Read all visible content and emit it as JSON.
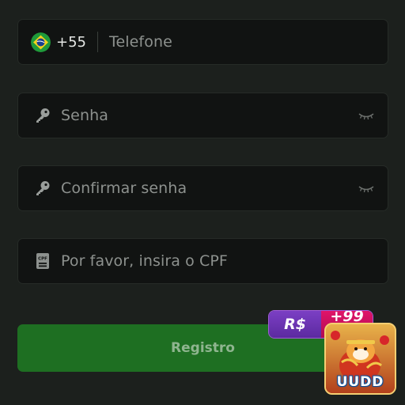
{
  "form": {
    "phone": {
      "country_code": "+55",
      "placeholder": "Telefone",
      "flag_icon": "brazil-flag-icon"
    },
    "password": {
      "placeholder": "Senha",
      "icon": "key-icon",
      "toggle_icon": "eye-closed-icon"
    },
    "confirm_password": {
      "placeholder": "Confirmar senha",
      "icon": "key-icon",
      "toggle_icon": "eye-closed-icon"
    },
    "cpf": {
      "placeholder": "Por favor, insira o CPF",
      "icon": "cpf-card-icon"
    }
  },
  "register_button": {
    "label": "Registro",
    "color": "#1e6f22"
  },
  "promo_badge": {
    "currency": "R$",
    "amount": "+99"
  },
  "app_logo": {
    "text": "UUDD"
  }
}
